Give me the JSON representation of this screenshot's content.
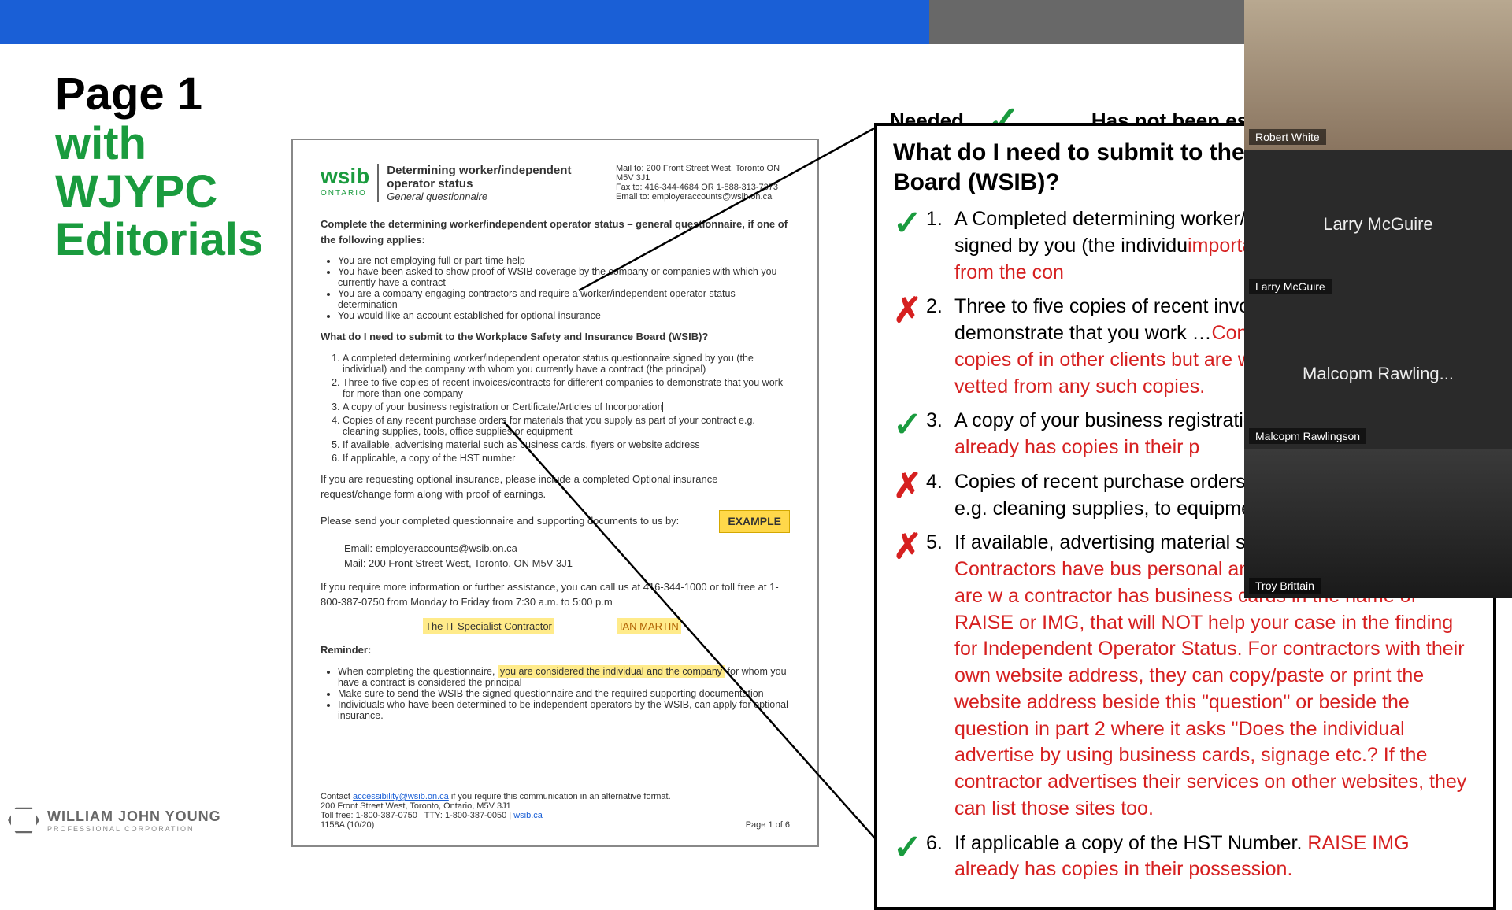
{
  "header": {
    "needed": "Needed",
    "has_not": "Has not been ess"
  },
  "title": {
    "line1": "Page 1",
    "line2": "with",
    "line3": "WJYPC",
    "line4": "Editorials"
  },
  "doc": {
    "logo": "wsib",
    "logo_sub": "ONTARIO",
    "title": "Determining worker/independent operator status",
    "subtitle": "General questionnaire",
    "mail": "Mail to: 200 Front Street West, Toronto ON  M5V 3J1",
    "fax": "Fax to: 416-344-4684 OR 1-888-313-7373",
    "email": "Email to: employeraccounts@wsib.on.ca",
    "intro": "Complete the determining worker/independent operator status – general questionnaire, if one of the following applies:",
    "bullets": [
      "You are not employing full or part-time help",
      "You have been asked to show proof of WSIB coverage by the company or companies with which you currently have a contract",
      "You are a company engaging contractors and require a worker/independent operator status determination",
      "You would like an account established for optional insurance"
    ],
    "q_heading": "What do I need to submit to the Workplace Safety and Insurance Board (WSIB)?",
    "q_items": [
      "A completed determining worker/independent operator status questionnaire signed by you (the individual) and the company with whom you currently have a contract (the principal)",
      "Three to five copies of recent invoices/contracts for different companies to demonstrate that you work for more than one company",
      "A copy of your business registration or Certificate/Articles of Incorporation",
      "Copies of any recent purchase orders for materials that you supply as part of your contract e.g. cleaning supplies, tools, office supplies or equipment",
      "If available, advertising material such as business cards, flyers or website address",
      "If applicable, a copy of the HST number"
    ],
    "optional": "If you are requesting optional insurance, please include a completed Optional insurance request/change form along with proof of earnings.",
    "send": "Please send your completed questionnaire and supporting documents to us by:",
    "example": "EXAMPLE",
    "email_line": "Email: employeraccounts@wsib.on.ca",
    "mail_line": "Mail: 200 Front Street West, Toronto, ON  M5V 3J1",
    "assist": "If you require more information or further assistance, you can call us at 416-344-1000 or toll free at 1-800-387-0750 from Monday to Friday from 7:30 a.m. to 5:00 p.m",
    "it_spec": "The IT Specialist Contractor",
    "ian": "IAN MARTIN",
    "reminder": "Reminder:",
    "rem1a": "When completing the questionnaire, ",
    "rem1b": "you are considered the individual and the company",
    "rem1c": " for whom you have a contract is considered the principal",
    "rem2": "Make sure to send the WSIB the signed questionnaire and the required supporting documentation",
    "rem3": "Individuals who have been determined to be independent operators by the WSIB, can apply for optional insurance.",
    "contact_a": "Contact ",
    "contact_link": "accessibility@wsib.on.ca",
    "contact_b": " if you require this communication in an alternative format.",
    "addr": "200 Front Street West, Toronto, Ontario, M5V 3J1",
    "toll": "Toll free: 1-800-387-0750 | TTY: 1-800-387-0050 | ",
    "wsib_link": "wsib.ca",
    "form_id": "1158A (10/20)",
    "page": "Page 1 of 6"
  },
  "zoom": {
    "heading": "What do I need to submit to the and Insurance Board (WSIB)?",
    "items": [
      {
        "mark": "check",
        "num": "1.",
        "text": "A Completed determining worker/indepen questionnaire signed by you (the individu",
        "red": "important document needed from the con"
      },
      {
        "mark": "x",
        "num": "2.",
        "text": "Three to five copies of recent invoices/co companies to demonstrate that you work …",
        "red": "Contractors rarely provide copies of in other clients but are welcome to do so. F be vetted from any such copies."
      },
      {
        "mark": "check",
        "num": "3.",
        "text": "A copy of your business registration or \"C",
        "red": "RAISE IMG already has copies in their p"
      },
      {
        "mark": "x",
        "num": "4.",
        "text": "Copies of recent purchase orders for ma of your contract e.g. cleaning supplies, to equipment.",
        "red": ""
      },
      {
        "mark": "x",
        "num": "5.",
        "text": "If available, advertising material such as website address. ",
        "red": "If Contractors have bus personal and business names they are w a contractor has business cards in the name of RAISE or IMG, that will NOT help your case in the finding for Independent Operator Status. For contractors with their own website address, they can copy/paste or print the website address beside this \"question\" or beside the question in part 2 where it asks \"Does the individual advertise by using business cards, signage etc.? If the contractor advertises their services on other websites, they can list those sites too."
      },
      {
        "mark": "check",
        "num": "6.",
        "text": "If applicable a copy of the HST Number. ",
        "red": "RAISE IMG already has copies in their possession."
      }
    ]
  },
  "participants": [
    {
      "name": "Robert White",
      "video": true
    },
    {
      "name": "Larry McGuire",
      "video": false,
      "display": "Larry McGuire"
    },
    {
      "name": "Malcopm Rawlingson",
      "video": false,
      "display": "Malcopm  Rawling..."
    },
    {
      "name": "Troy Brittain",
      "video": false,
      "display": ""
    }
  ],
  "logo": {
    "main": "WILLIAM JOHN YOUNG",
    "sub": "PROFESSIONAL CORPORATION"
  }
}
